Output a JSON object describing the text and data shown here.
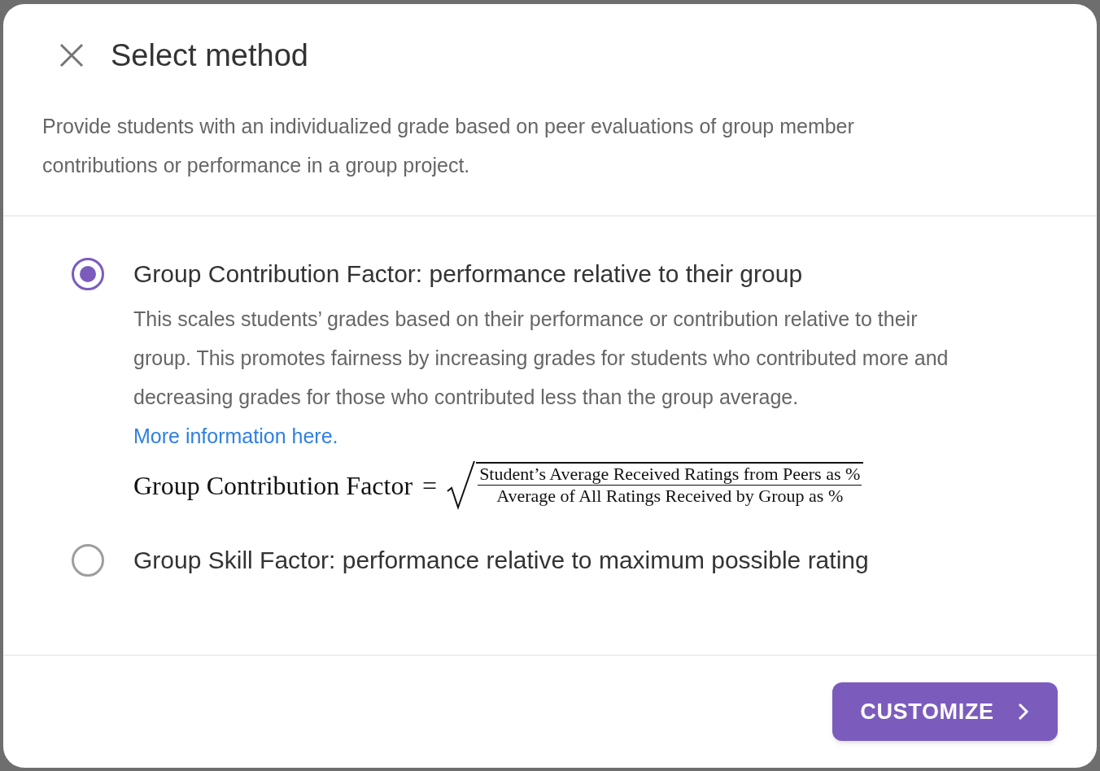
{
  "dialog": {
    "title": "Select method",
    "description": "Provide students with an individualized grade based on peer evaluations of group member contributions or performance in a group project.",
    "options": [
      {
        "label": "Group Contribution Factor: performance relative to their group",
        "selected": true,
        "description": "This scales students’ grades based on their performance or contribution relative to their group. This promotes fairness by increasing grades for students who contributed more and decreasing grades for those who contributed less than the group average.",
        "link": "More information here.",
        "formula": {
          "lhs": "Group Contribution Factor",
          "operator": "=",
          "numerator": "Student’s Average Received Ratings from Peers as %",
          "denominator": "Average of All Ratings Received by Group as %"
        }
      },
      {
        "label": "Group Skill Factor: performance relative to maximum possible rating",
        "selected": false
      }
    ],
    "button": "CUSTOMIZE"
  }
}
